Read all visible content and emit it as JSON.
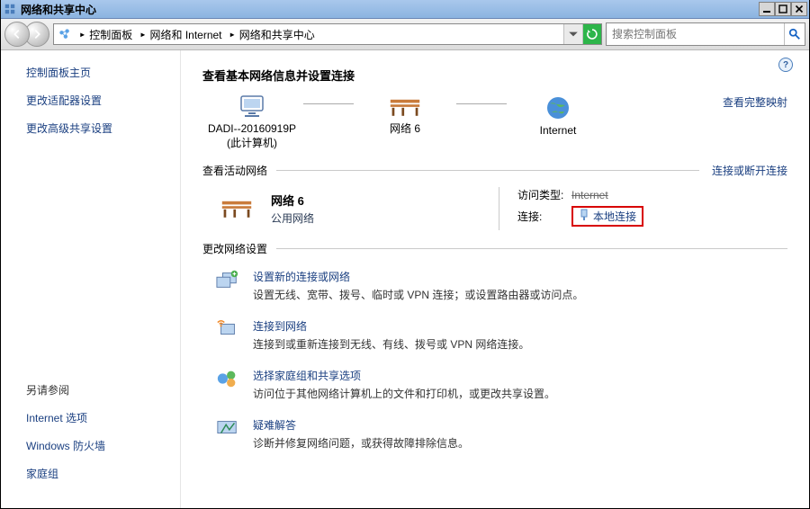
{
  "window": {
    "title": "网络和共享中心"
  },
  "address": {
    "icon": "network-center-icon",
    "crumbs": [
      "控制面板",
      "网络和 Internet",
      "网络和共享中心"
    ]
  },
  "search": {
    "placeholder": "搜索控制面板"
  },
  "sidebar": {
    "top": [
      "控制面板主页",
      "更改适配器设置",
      "更改高级共享设置"
    ],
    "see_also_heading": "另请参阅",
    "bottom": [
      "Internet 选项",
      "Windows 防火墙",
      "家庭组"
    ]
  },
  "main": {
    "help": "?",
    "heading": "查看基本网络信息并设置连接",
    "topo": {
      "computer": {
        "name": "DADI--20160919P",
        "sub": "(此计算机)"
      },
      "network": {
        "name": "网络  6"
      },
      "internet": {
        "name": "Internet"
      },
      "view_map": "查看完整映射"
    },
    "active_networks": {
      "label": "查看活动网络",
      "connect_disconnect": "连接或断开连接",
      "network_name": "网络  6",
      "network_type": "公用网络",
      "rows": {
        "access_label": "访问类型:",
        "access_value": "Internet",
        "conn_label": "连接:",
        "conn_value": "本地连接"
      }
    },
    "change_settings": {
      "label": "更改网络设置",
      "items": [
        {
          "icon": "new-connection-icon",
          "title": "设置新的连接或网络",
          "desc": "设置无线、宽带、拨号、临时或 VPN 连接；或设置路由器或访问点。"
        },
        {
          "icon": "connect-network-icon",
          "title": "连接到网络",
          "desc": "连接到或重新连接到无线、有线、拨号或 VPN 网络连接。"
        },
        {
          "icon": "homegroup-icon",
          "title": "选择家庭组和共享选项",
          "desc": "访问位于其他网络计算机上的文件和打印机，或更改共享设置。"
        },
        {
          "icon": "troubleshoot-icon",
          "title": "疑难解答",
          "desc": "诊断并修复网络问题，或获得故障排除信息。"
        }
      ]
    }
  }
}
